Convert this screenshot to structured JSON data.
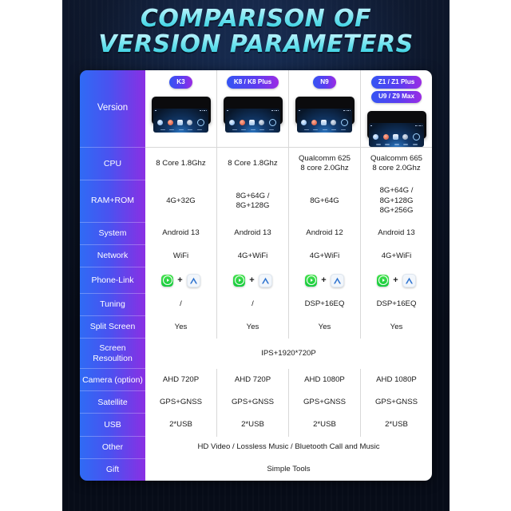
{
  "poster": {
    "title_line_1": "COMPARISON OF",
    "title_line_2": "VERSION PARAMETERS",
    "accent_cyan": "#6fe3ef",
    "background_navy": "#0a1120",
    "label_gradient_from": "#2f6bf5",
    "label_gradient_to": "#8a2fe3"
  },
  "table": {
    "row_labels": {
      "version": "Version",
      "cpu": "CPU",
      "ram_rom": "RAM+ROM",
      "system": "System",
      "network": "Network",
      "phone_link": "Phone-Link",
      "tuning": "Tuning",
      "split_screen": "Split Screen",
      "screen_resolution": "Screen\nResoultion",
      "camera": "Camera\n(option)",
      "satellite": "Satellite",
      "usb": "USB",
      "other": "Other",
      "gift": "Gift"
    },
    "columns": [
      {
        "badges": [
          "K3"
        ]
      },
      {
        "badges": [
          "K8 / K8 Plus"
        ]
      },
      {
        "badges": [
          "N9"
        ]
      },
      {
        "badges": [
          "Z1 / Z1 Plus",
          "U9 / Z9 Max"
        ]
      }
    ],
    "rows": {
      "cpu": [
        "8 Core 1.8Ghz",
        "8 Core 1.8Ghz",
        "Qualcomm 625\n8 core 2.0Ghz",
        "Qualcomm 665\n8 core 2.0Ghz"
      ],
      "ram_rom": [
        "4G+32G",
        "8G+64G / 8G+128G",
        "8G+64G",
        "8G+64G / 8G+128G\n8G+256G"
      ],
      "system": [
        "Android 13",
        "Android 13",
        "Android 12",
        "Android 13"
      ],
      "network": [
        "WiFi",
        "4G+WiFi",
        "4G+WiFi",
        "4G+WiFi"
      ],
      "tuning": [
        "/",
        "/",
        "DSP+16EQ",
        "DSP+16EQ"
      ],
      "split_screen": [
        "Yes",
        "Yes",
        "Yes",
        "Yes"
      ],
      "screen_resolution_merged": "IPS+1920*720P",
      "camera": [
        "AHD 720P",
        "AHD 720P",
        "AHD 1080P",
        "AHD 1080P"
      ],
      "satellite": [
        "GPS+GNSS",
        "GPS+GNSS",
        "GPS+GNSS",
        "GPS+GNSS"
      ],
      "usb": [
        "2*USB",
        "2*USB",
        "2*USB",
        "2*USB"
      ],
      "other_merged": "HD Video / Lossless Music / Bluetooth Call and Music",
      "gift_merged": "Simple Tools"
    },
    "phone_link": {
      "plus": "+",
      "icon_left": "carplay-icon",
      "icon_right": "android-auto-icon"
    }
  }
}
